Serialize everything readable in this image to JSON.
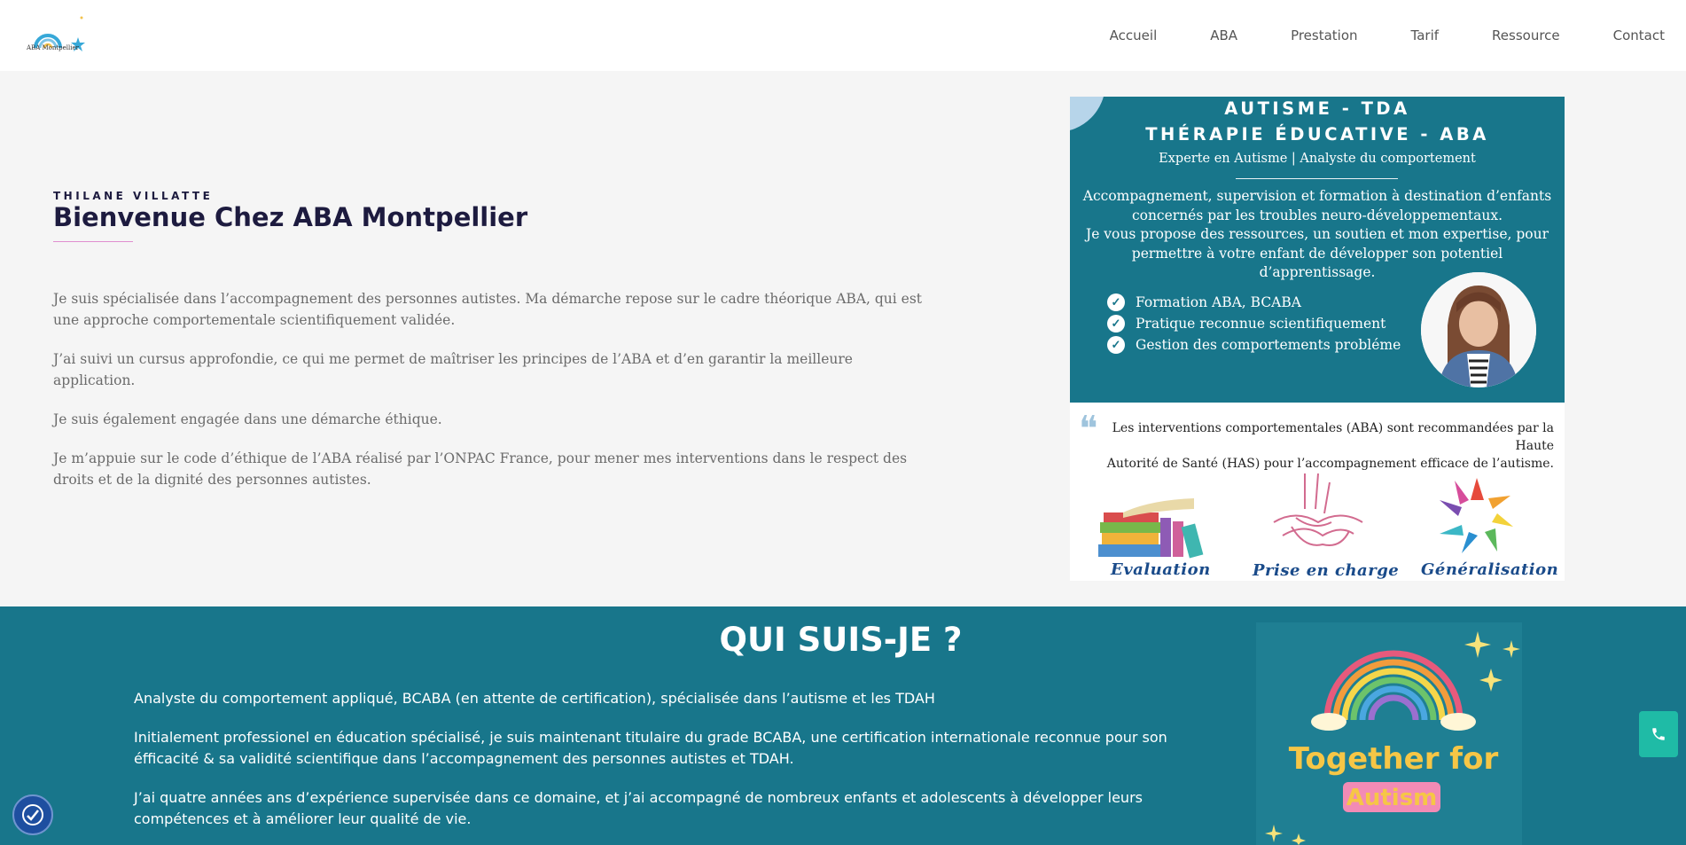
{
  "header": {
    "logo_text": "ABA Montpellier",
    "nav": [
      "Accueil",
      "ABA",
      "Prestation",
      "Tarif",
      "Ressource",
      "Contact"
    ]
  },
  "hero": {
    "eyebrow": "THILANE VILLATTE",
    "title": "Bienvenue Chez ABA Montpellier",
    "paragraphs": [
      "Je suis spécialisée dans l’accompagnement des personnes autistes. Ma démarche repose sur le cadre théorique ABA, qui est une approche comportementale scientifiquement validée.",
      "J’ai suivi un cursus approfondie, ce qui me permet de maîtriser les principes de l’ABA et d’en garantir la meilleure application.",
      "Je suis également engagée dans une démarche éthique.",
      "Je m’appuie sur le code d’éthique de l’ABA réalisé par l’ONPAC France, pour mener mes interventions dans le respect des droits et de la dignité des personnes autistes."
    ]
  },
  "flyer": {
    "heading1": "AUTISME - TDA",
    "heading2": "THÉRAPIE ÉDUCATIVE - ABA",
    "subtitle": "Experte en Autisme | Analyste du comportement",
    "description": [
      "Accompagnement, supervision et formation à destination d’enfants",
      "concernés par les troubles neuro-développementaux.",
      "Je vous propose des ressources, un soutien et mon expertise, pour",
      "permettre à votre enfant de développer son potentiel d’apprentissage."
    ],
    "list": [
      "Formation  ABA, BCABA",
      "Pratique reconnue scientifiquement",
      "Gestion des comportements probléme"
    ],
    "quote_mark": "❝",
    "quote": [
      "Les interventions comportementales (ABA) sont recommandées par la Haute",
      "Autorité de Santé (HAS) pour l’accompagnement efficace de l’autisme."
    ],
    "labels": [
      "Evaluation",
      "Prise en charge",
      "Généralisation"
    ]
  },
  "about": {
    "title": "QUI SUIS-JE ?",
    "paragraphs": [
      "Analyste du comportement appliqué, BCABA (en attente de certification), spécialisée dans l’autisme et les TDAH",
      "Initialement professionel en éducation spécialisé, je suis maintenant titulaire du grade BCABA, une certification internationale reconnue pour son éfficacité & sa validité scientifique dans l’accompagnement des personnes autistes et TDAH.",
      "J’ai quatre années ans d’expérience supervisée dans ce domaine, et j’ai accompagné de nombreux enfants et adolescents à développer leurs compétences et à améliorer leur qualité de vie."
    ],
    "image_text": [
      "Together for",
      "Autism"
    ]
  },
  "colors": {
    "teal": "#18768b",
    "navy": "#1d1b3f",
    "phone_button": "#1fbba6",
    "accessibility_button": "#1e4fa0"
  },
  "icons": [
    "phone-icon",
    "accessibility-icon",
    "check-icon",
    "rainbow-icon",
    "quote-icon"
  ]
}
